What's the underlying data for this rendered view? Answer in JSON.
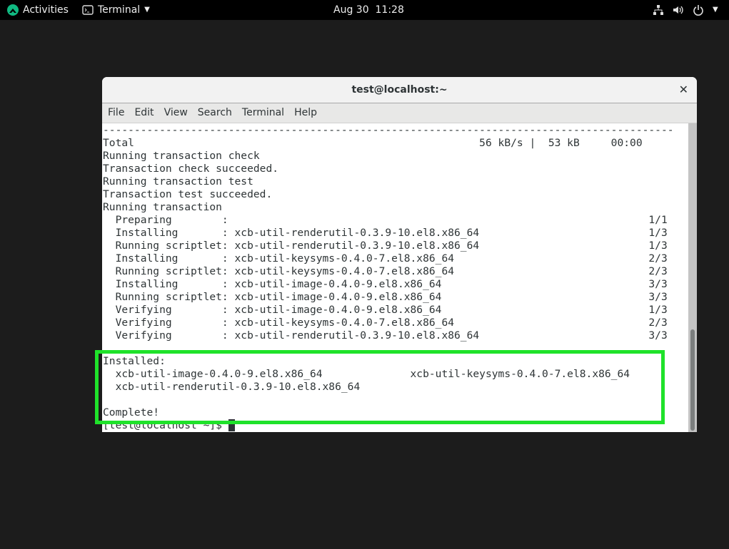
{
  "topbar": {
    "activities": "Activities",
    "app": "Terminal",
    "clock": "Aug 30  11:28",
    "icons": [
      "network-icon",
      "volume-icon",
      "power-icon",
      "chevron-down-icon"
    ]
  },
  "window": {
    "title": "test@localhost:~",
    "menu": [
      "File",
      "Edit",
      "View",
      "Search",
      "Terminal",
      "Help"
    ]
  },
  "terminal": {
    "summary": {
      "label": "Total",
      "speed": "56 kB/s",
      "size": "53 kB",
      "time": "00:00"
    },
    "messages": [
      "Running transaction check",
      "Transaction check succeeded.",
      "Running transaction test",
      "Transaction test succeeded.",
      "Running transaction"
    ],
    "steps": [
      {
        "step": "Preparing",
        "pkg": "",
        "count": "1/1"
      },
      {
        "step": "Installing",
        "pkg": "xcb-util-renderutil-0.3.9-10.el8.x86_64",
        "count": "1/3"
      },
      {
        "step": "Running scriptlet",
        "pkg": "xcb-util-renderutil-0.3.9-10.el8.x86_64",
        "count": "1/3"
      },
      {
        "step": "Installing",
        "pkg": "xcb-util-keysyms-0.4.0-7.el8.x86_64",
        "count": "2/3"
      },
      {
        "step": "Running scriptlet",
        "pkg": "xcb-util-keysyms-0.4.0-7.el8.x86_64",
        "count": "2/3"
      },
      {
        "step": "Installing",
        "pkg": "xcb-util-image-0.4.0-9.el8.x86_64",
        "count": "3/3"
      },
      {
        "step": "Running scriptlet",
        "pkg": "xcb-util-image-0.4.0-9.el8.x86_64",
        "count": "3/3"
      },
      {
        "step": "Verifying",
        "pkg": "xcb-util-image-0.4.0-9.el8.x86_64",
        "count": "1/3"
      },
      {
        "step": "Verifying",
        "pkg": "xcb-util-keysyms-0.4.0-7.el8.x86_64",
        "count": "2/3"
      },
      {
        "step": "Verifying",
        "pkg": "xcb-util-renderutil-0.3.9-10.el8.x86_64",
        "count": "3/3"
      }
    ],
    "installed_label": "Installed:",
    "installed": [
      "xcb-util-image-0.4.0-9.el8.x86_64",
      "xcb-util-keysyms-0.4.0-7.el8.x86_64",
      "xcb-util-renderutil-0.3.9-10.el8.x86_64"
    ],
    "complete": "Complete!",
    "prompt": "[test@localhost ~]$ "
  },
  "scrollbar": {
    "position_fraction": 1.0
  },
  "colors": {
    "highlight": "#1fe22a",
    "topbar": "#000000",
    "terminal_fg": "#2e3436"
  }
}
